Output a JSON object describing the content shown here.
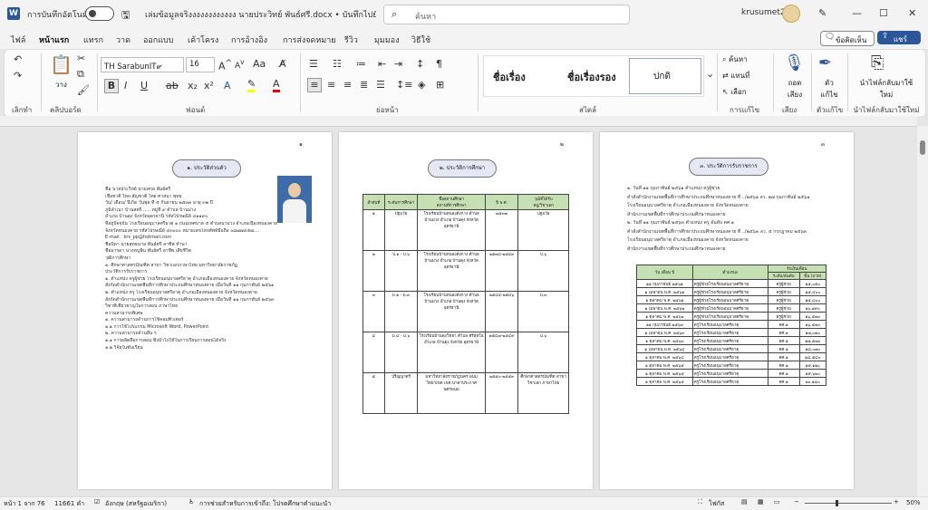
{
  "titlebar": {
    "autosave_label": "การบันทึกอัตโนมัติ",
    "doc_title": "เล่มข้อมูลจริงงงงงงงงงงงง นายประวิทย์  พันธ์ศรี.docx • บันทึกไปยัง พีซีนี้",
    "search_placeholder": "ค้นหา",
    "user_name": "krusumet2",
    "minimize": "—",
    "maximize": "☐",
    "close": "✕"
  },
  "tabs": [
    "ไฟล์",
    "หน้าแรก",
    "แทรก",
    "วาด",
    "ออกแบบ",
    "เค้าโครง",
    "การอ้างอิง",
    "การส่งจดหมาย",
    "รีวิว",
    "มุมมอง",
    "วิธีใช้"
  ],
  "right_buttons": {
    "comments": "ข้อคิดเห็น",
    "share": "แชร์"
  },
  "ribbon": {
    "undo_label": "เลิกทำ",
    "clipboard_label": "คลิปบอร์ด",
    "paste_label": "วาง",
    "font_name": "TH SarabunIT๙",
    "font_size": "16",
    "font_label": "ฟอนต์",
    "paragraph_label": "ย่อหน้า",
    "styles_label": "สไตล์",
    "styles": [
      "ชื่อเรื่อง",
      "ชื่อเรื่องรอง",
      "ปกติ"
    ],
    "editing_label": "การแก้ไข",
    "find": "ค้นหา",
    "replace": "แทนที่",
    "select": "เลือก",
    "voice_label": "เสียง",
    "dictate": "ถอดเสียง",
    "editor_label": "ตัวแก้ไข",
    "editor": "ตัวแก้ไข",
    "reuse_label": "นำไฟล์กลับมาใช้ใหม่",
    "reuse": "นำไฟล์กลับมาใช้ใหม่",
    "bold": "B",
    "italic": "I",
    "underline": "U",
    "strike": "ab",
    "sub": "x₂",
    "sup": "x²"
  },
  "pages": {
    "p1_title": "๑. ประวัติส่วนตัว",
    "p1_lines": [
      "ชื่อ  นายประวิทย์        นามสกุล  พันธ์ศรี",
      "เชื้อชาติ  ไทย   สัญชาติ  ไทย   ศาสนา  พุทธ",
      "วัน/ เดือน/ ปีเกิด    วันพุธ ที่ ๕ กันยายน ๒๕๓๓ อายุ ๓๒ ปี",
      "ภูมิลำเนา  บ้านสตรี ..... หมู่ที่ ๙ ตำบล บ้านม่วง",
      "อำเภอ บ้านดุง  จังหวัดอุดรธานี   รหัสไปรษณีย์ ๔๑๑๙๐",
      "ที่อยู่ปัจจุบัน   โรงเรียนอนุบาลศรีธาตุ ๑ ถนนเทศบาล ๕ ตำบลนาม่วง  อำเภอเมืองหนองคาย",
      "จังหวัดหนองคาย  รหัสไปรษณีย์ ๔๓๐๐๐  หมายเลขโทรศัพท์มือถือ  ๐๘๗๗๔๕๗....",
      "E-mail : krs_pp@hotmail.com",
      "ชื่อบิดา   นายสุทธนาม   พันธ์ศรี      อาชีพ  ทำนา",
      "ชื่อมารดา  นางหนูพิน   พันธ์ศรี      อาชีพ  เสียชีวิต",
      "วุฒิการศึกษา",
      "    ๑. ศึกษาศาสตรบัณฑิต สาขา วิชาเอกภาษาไทย มหาวิทยาลัยราชภัฏ",
      "ประวัติการรับราชการ",
      "    ๑. ตำแหน่ง ครูผู้ช่วย  โรงเรียนอนุบาลศรีธาตุ อำเภอเมืองหนองคาย จังหวัดหนองคาย",
      "สังกัดสำนักงานเขตพื้นที่การศึกษาประถมศึกษาหนองคาย เมื่อวันที่  ๑๑ กุมภาพันธ์ ๒๕๖๑",
      "    ๒. ตำแหน่ง ครู โรงเรียนอนุบาลศรีธาตุ อำเภอเมืองหนองคาย จังหวัดหนองคาย",
      "สังกัดสำนักงานเขตพื้นที่การศึกษาประถมศึกษาหนองคาย เมื่อวันที่  ๑๑ กุมภาพันธ์ ๒๕๖๓",
      "วิชาที่เชี่ยวชาญในการสอน   ภาษาไทย",
      "ความสามารถพิเศษ",
      "    ๑. ความสามารถด้านการใช้คอมพิวเตอร์",
      "         ๑.๑ การใช้โปรแกรม Microsoft Word, PowerPoint",
      "    ๒. ความสามารถด้านอื่น ๆ",
      "         ๑.๑ การผลิตสื่อการสอน ซึ่งนำไปใช้ในการเรียนการสอนได้จริง",
      "         ๑.๒ วิจัยในชั้นเรียน"
    ],
    "p2_title": "๒. ประวัติการศึกษา",
    "p2_headers": [
      "ลำดับที่",
      "ระดับการศึกษา",
      "ชื่อสถานศึกษา\nสถานที่การศึกษา",
      "ปี พ.ศ.",
      "วุฒิที่ได้รับ\nหมู่/วิชาเอก"
    ],
    "p2_rows": [
      [
        "๑",
        "ปฐมวัย",
        "โรงเรียนบ้านหนองตั่งกาง ตำบล บ้านม่วง อำเภอ บ้านดุง จังหวัด อุดรธานี",
        "๒๕๓๗",
        "ปฐมวัย"
      ],
      [
        "๒",
        "ป.๑ - ป.๖",
        "โรงเรียนบ้านหนองตั่งกาง ตำบล บ้านม่วง อำเภอ บ้านดุง จังหวัด อุดรธานี",
        "๒๕๓๘-๒๕๔๓",
        "ป.๖"
      ],
      [
        "๓",
        "ม.๑ - ม.๓",
        "โรงเรียนบ้านหนองตั่งกาง ตำบล บ้านม่วง อำเภอ บ้านดุง จังหวัด อุดรธานี",
        "๒๕๔๔-๒๕๔๖",
        "ม.๓"
      ],
      [
        "๔",
        "ม.๔ - ม.๖",
        "โรงเรียนบ้านดุงวิทยา ตำบล ศรีสุทโธ อำเภอ บ้านดุง จังหวัด อุดรธานี",
        "๒๕๔๗-๒๕๔๙",
        "ม.๖"
      ],
      [
        "๕",
        "ปริญญาตรี",
        "มหาวิทยาลัยราชภัฏนคร พนม วิทยาเขต เขต นาคาประกาศ นครพนม",
        "๒๕๕๐-๒๕๕๓",
        "ศึกษาศาสตรบัณฑิต สาขาวิชาเอก ภาษาไทย"
      ]
    ],
    "p3_title": "๓. ประวัติการรับราชการ",
    "p3_lines": [
      "    ๑. วันที่ ๑๑ กุมภาพันธ์ ๒๕๖๑      ตำแหน่ง ครูผู้ช่วย",
      "คำสั่งสำนักงานเขตพื้นที่การศึกษาประถมศึกษาหนองคาย ที่ ../๒๕๖๑ ลว. ๒๗ กุมภาพันธ์ ๒๕๖๑",
      "โรงเรียนอนุบาลศรีธาตุ อำเภอเมืองหนองคาย จังหวัดหนองคาย",
      "สำนักงานเขตพื้นที่การศึกษาประถมศึกษาหนองคาย",
      "    ๒. วันที่ ๑๑ กุมภาพันธ์ ๒๕๖๓      ตำแหน่ง ครู อันดับ คศ.๑",
      "คำสั่งสำนักงานเขตพื้นที่การศึกษาประถมศึกษาหนองคาย ที่ ../๒๕๖๓ ลว. ๕ กรกฎาคม ๒๕๖๓",
      "โรงเรียนอนุบาลศรีธาตุ อำเภอเมืองหนองคาย จังหวัดหนองคาย",
      "สำนักงานเขตพื้นที่การศึกษาประถมศึกษาหนองคาย"
    ],
    "p3_headers": [
      "วัน เดือน ปี",
      "ตำแหน่ง",
      "ระดับ/อันดับ",
      "ขั้น (บาท)"
    ],
    "p3_group_header": "รับเงินเดือน",
    "p3_rows": [
      [
        "๑๑ กุมภาพันธ์ ๒๕๖๑",
        "ครูผู้ช่วยโรงเรียนอนุบาลศรีธาตุ",
        "ครูผู้ช่วย",
        "๑๕,๐๕๐"
      ],
      [
        "๑ เมษายน พ.ศ. ๒๕๖๑",
        "ครูผู้ช่วยโรงเรียนอนุบาลศรีธาตุ",
        "ครูผู้ช่วย",
        "๑๕,๔๐๐"
      ],
      [
        "๑ ตุลาคม พ.ศ. ๒๕๖๑",
        "ครูผู้ช่วยโรงเรียนอนุบาลศรีธาตุ",
        "ครูผู้ช่วย",
        "๑๕,๘๐๐"
      ],
      [
        "๑ เมษายน พ.ศ. ๒๕๖๒",
        "ครูผู้ช่วยโรงเรียนอนุบาลศรีธาตุ",
        "ครูผู้ช่วย",
        "๑๖,๑๙๐"
      ],
      [
        "๑ ตุลาคม พ.ศ. ๒๕๖๒",
        "ครูผู้ช่วยโรงเรียนอนุบาลศรีธาตุ",
        "ครูผู้ช่วย",
        "๑๖,๕๗๐"
      ],
      [
        "๑๑ กุมภาพันธ์ ๒๕๖๓",
        "ครูโรงเรียนอนุบาลศรีธาตุ",
        "คศ.๑",
        "๑๖,๕๗๐"
      ],
      [
        "๑ เมษายน พ.ศ. ๒๕๖๓",
        "ครูโรงเรียนอนุบาลศรีธาตุ",
        "คศ.๑",
        "๑๗,๐๗๐"
      ],
      [
        "๑ ตุลาคม พ.ศ. ๒๕๖๓",
        "ครูโรงเรียนอนุบาลศรีธาตุ",
        "คศ.๑",
        "๑๗,๕๗๐"
      ],
      [
        "๑ เมษายน พ.ศ. ๒๕๖๔",
        "ครูโรงเรียนอนุบาลศรีธาตุ",
        "คศ.๑",
        "๑๘,๐๗๐"
      ],
      [
        "๑ ตุลาคม พ.ศ. ๒๕๖๔",
        "ครูโรงเรียนอนุบาลศรีธาตุ",
        "คศ.๑",
        "๑๘,๕๘๐"
      ],
      [
        "๑ ตุลาคม พ.ศ. ๒๕๖๕",
        "ครูโรงเรียนอนุบาลศรีธาตุ",
        "คศ.๑",
        "๑๙,๑๑๐"
      ],
      [
        "๑ ตุลาคม พ.ศ. ๒๕๖๕",
        "ครูโรงเรียนอนุบาลศรีธาตุ",
        "คศ.๑",
        "๑๙,๖๒๐"
      ],
      [
        "๑ ตุลาคม พ.ศ. ๒๕๖๕",
        "ครูโรงเรียนอนุบาลศรีธาตุ",
        "คศ.๑",
        "๒๐,๑๘๐"
      ]
    ],
    "page_marks": [
      "๑",
      "๒",
      "๓"
    ]
  },
  "status": {
    "page": "หน้า 1 จาก 76",
    "words": "11661 คำ",
    "language": "อังกฤษ (สหรัฐอเมริกา)",
    "accessibility": "การช่วยสำหรับการเข้าถึง: โปรดศึกษาคำแนะนำ",
    "focus": "โฟกัส",
    "zoom": "50%",
    "zoom_out": "−",
    "zoom_in": "+"
  }
}
